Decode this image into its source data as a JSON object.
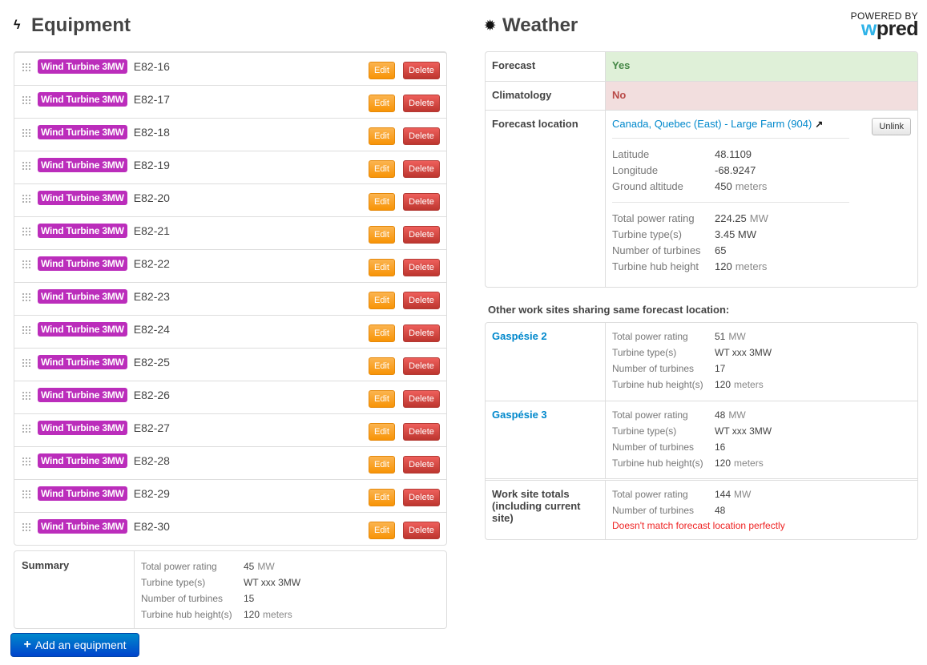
{
  "equipment": {
    "title": "Equipment",
    "title_icon": "lightning-bolt-icon",
    "items": [
      {
        "type": "Wind Turbine 3MW",
        "name": "E82-16"
      },
      {
        "type": "Wind Turbine 3MW",
        "name": "E82-17"
      },
      {
        "type": "Wind Turbine 3MW",
        "name": "E82-18"
      },
      {
        "type": "Wind Turbine 3MW",
        "name": "E82-19"
      },
      {
        "type": "Wind Turbine 3MW",
        "name": "E82-20"
      },
      {
        "type": "Wind Turbine 3MW",
        "name": "E82-21"
      },
      {
        "type": "Wind Turbine 3MW",
        "name": "E82-22"
      },
      {
        "type": "Wind Turbine 3MW",
        "name": "E82-23"
      },
      {
        "type": "Wind Turbine 3MW",
        "name": "E82-24"
      },
      {
        "type": "Wind Turbine 3MW",
        "name": "E82-25"
      },
      {
        "type": "Wind Turbine 3MW",
        "name": "E82-26"
      },
      {
        "type": "Wind Turbine 3MW",
        "name": "E82-27"
      },
      {
        "type": "Wind Turbine 3MW",
        "name": "E82-28"
      },
      {
        "type": "Wind Turbine 3MW",
        "name": "E82-29"
      },
      {
        "type": "Wind Turbine 3MW",
        "name": "E82-30"
      }
    ],
    "edit_label": "Edit",
    "delete_label": "Delete",
    "summary": {
      "label": "Summary",
      "rows": [
        {
          "key": "Total power rating",
          "value": "45",
          "unit": "MW"
        },
        {
          "key": "Turbine type(s)",
          "value": "WT xxx 3MW",
          "unit": ""
        },
        {
          "key": "Number of turbines",
          "value": "15",
          "unit": ""
        },
        {
          "key": "Turbine hub height(s)",
          "value": "120",
          "unit": "meters"
        }
      ]
    },
    "add_button": "Add an equipment"
  },
  "weather": {
    "title": "Weather",
    "title_icon": "sun-icon",
    "logo": {
      "powered_by": "POWERED BY",
      "brand_w": "w",
      "brand_rest": "pred"
    },
    "forecast": {
      "label": "Forecast",
      "value": "Yes"
    },
    "climatology": {
      "label": "Climatology",
      "value": "No"
    },
    "forecast_location": {
      "label": "Forecast location",
      "link": "Canada, Quebec (East) - Large Farm (904)",
      "unlink_label": "Unlink",
      "geo": [
        {
          "key": "Latitude",
          "value": "48.1109",
          "unit": ""
        },
        {
          "key": "Longitude",
          "value": "-68.9247",
          "unit": ""
        },
        {
          "key": "Ground altitude",
          "value": "450",
          "unit": "meters"
        }
      ],
      "farm": [
        {
          "key": "Total power rating",
          "value": "224.25",
          "unit": "MW"
        },
        {
          "key": "Turbine type(s)",
          "value": "3.45 MW",
          "unit": ""
        },
        {
          "key": "Number of turbines",
          "value": "65",
          "unit": ""
        },
        {
          "key": "Turbine hub height",
          "value": "120",
          "unit": "meters"
        }
      ]
    },
    "other_sites_title": "Other work sites sharing same forecast location:",
    "other_sites": [
      {
        "name": "Gaspésie 2",
        "rows": [
          {
            "key": "Total power rating",
            "value": "51",
            "unit": "MW"
          },
          {
            "key": "Turbine type(s)",
            "value": "WT xxx 3MW",
            "unit": ""
          },
          {
            "key": "Number of turbines",
            "value": "17",
            "unit": ""
          },
          {
            "key": "Turbine hub height(s)",
            "value": "120",
            "unit": "meters"
          }
        ]
      },
      {
        "name": "Gaspésie 3",
        "rows": [
          {
            "key": "Total power rating",
            "value": "48",
            "unit": "MW"
          },
          {
            "key": "Turbine type(s)",
            "value": "WT xxx 3MW",
            "unit": ""
          },
          {
            "key": "Number of turbines",
            "value": "16",
            "unit": ""
          },
          {
            "key": "Turbine hub height(s)",
            "value": "120",
            "unit": "meters"
          }
        ]
      }
    ],
    "totals": {
      "label": "Work site totals (including current site)",
      "rows": [
        {
          "key": "Total power rating",
          "value": "144",
          "unit": "MW"
        },
        {
          "key": "Number of turbines",
          "value": "48",
          "unit": ""
        }
      ],
      "warning": "Doesn't match forecast location perfectly"
    }
  }
}
